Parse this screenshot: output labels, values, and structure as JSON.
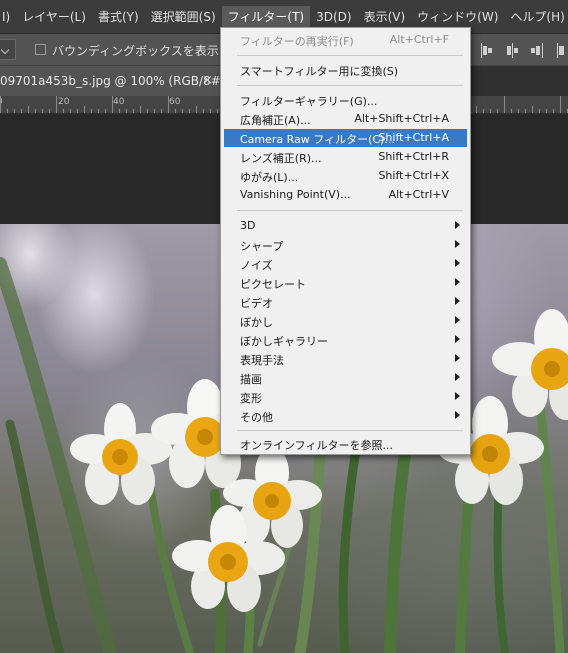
{
  "menubar": {
    "items": [
      {
        "label": "I)"
      },
      {
        "label": "レイヤー(L)"
      },
      {
        "label": "書式(Y)"
      },
      {
        "label": "選択範囲(S)"
      },
      {
        "label": "フィルター(T)"
      },
      {
        "label": "3D(D)"
      },
      {
        "label": "表示(V)"
      },
      {
        "label": "ウィンドウ(W)"
      },
      {
        "label": "ヘルプ(H)"
      }
    ],
    "active_index": 4
  },
  "options": {
    "bounding_box_label": "バウンディングボックスを表示",
    "bounding_box_checked": false
  },
  "document": {
    "tab_title": "09701a453b_s.jpg @ 100% (RGB/8#)",
    "close_glyph": "×"
  },
  "ruler": {
    "labels": [
      "0",
      "20",
      "40",
      "60"
    ]
  },
  "filter_menu": {
    "items": [
      {
        "label": "フィルターの再実行(F)",
        "shortcut": "Alt+Ctrl+F",
        "disabled": true
      },
      {
        "label": "スマートフィルター用に変換(S)",
        "shortcut": ""
      },
      {
        "label": "フィルターギャラリー(G)...",
        "shortcut": ""
      },
      {
        "label": "広角補正(A)...",
        "shortcut": "Alt+Shift+Ctrl+A"
      },
      {
        "label": "Camera Raw フィルター(C)...",
        "shortcut": "Shift+Ctrl+A",
        "highlighted": true
      },
      {
        "label": "レンズ補正(R)...",
        "shortcut": "Shift+Ctrl+R"
      },
      {
        "label": "ゆがみ(L)...",
        "shortcut": "Shift+Ctrl+X"
      },
      {
        "label": "Vanishing Point(V)...",
        "shortcut": "Alt+Ctrl+V"
      },
      {
        "label": "3D",
        "submenu": true
      },
      {
        "label": "シャープ",
        "submenu": true
      },
      {
        "label": "ノイズ",
        "submenu": true
      },
      {
        "label": "ピクセレート",
        "submenu": true
      },
      {
        "label": "ビデオ",
        "submenu": true
      },
      {
        "label": "ぼかし",
        "submenu": true
      },
      {
        "label": "ぼかしギャラリー",
        "submenu": true
      },
      {
        "label": "表現手法",
        "submenu": true
      },
      {
        "label": "描画",
        "submenu": true
      },
      {
        "label": "変形",
        "submenu": true
      },
      {
        "label": "その他",
        "submenu": true
      },
      {
        "label": "オンラインフィルターを参照...",
        "shortcut": ""
      }
    ]
  },
  "colors": {
    "highlight": "#3b79c3",
    "menubar_bg": "#3c3c3c",
    "menu_bg": "#f0f0f0"
  }
}
